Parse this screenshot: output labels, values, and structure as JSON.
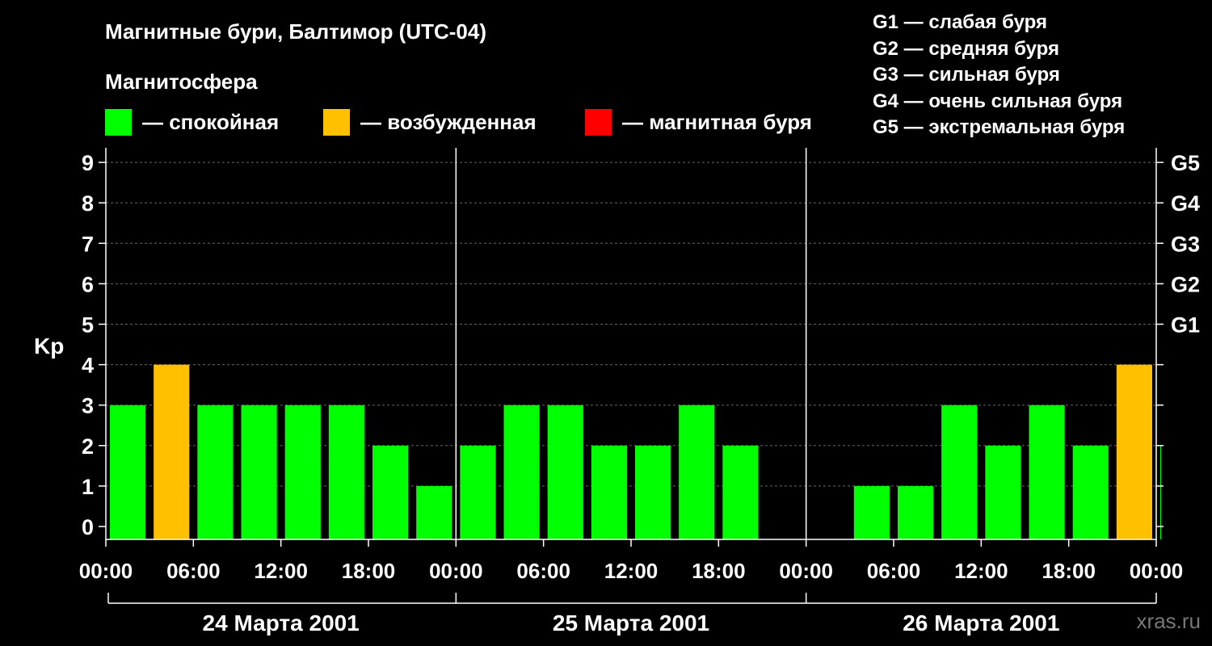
{
  "title": "Магнитные бури, Балтимор (UTC-04)",
  "subtitle": "Магнитосфера",
  "legend": [
    {
      "color": "#00ff00",
      "label": "— спокойная"
    },
    {
      "color": "#ffc000",
      "label": "— возбужденная"
    },
    {
      "color": "#ff0000",
      "label": "— магнитная буря"
    }
  ],
  "storm_levels": [
    "G1 — слабая буря",
    "G2 — средняя буря",
    "G3 — сильная буря",
    "G4 — очень сильная буря",
    "G5 — экстремальная буря"
  ],
  "watermark": "xras.ru",
  "chart_data": {
    "type": "bar",
    "ylabel": "Kp",
    "ylim": [
      0,
      9
    ],
    "yticks": [
      0,
      1,
      2,
      3,
      4,
      5,
      6,
      7,
      8,
      9
    ],
    "right_ticks": [
      {
        "value": 5,
        "label": "G1"
      },
      {
        "value": 6,
        "label": "G2"
      },
      {
        "value": 7,
        "label": "G3"
      },
      {
        "value": 8,
        "label": "G4"
      },
      {
        "value": 9,
        "label": "G5"
      }
    ],
    "grid": true,
    "x_tick_labels": [
      "00:00",
      "06:00",
      "12:00",
      "18:00",
      "00:00",
      "06:00",
      "12:00",
      "18:00",
      "00:00",
      "06:00",
      "12:00",
      "18:00",
      "00:00"
    ],
    "days": [
      "24 Марта 2001",
      "25 Марта 2001",
      "26 Марта 2001"
    ],
    "quiet_color": "#00ff00",
    "active_color": "#ffc000",
    "storm_color": "#ff0000",
    "bars": [
      {
        "day": 0,
        "hour": 0,
        "kp": 3
      },
      {
        "day": 0,
        "hour": 3,
        "kp": 4
      },
      {
        "day": 0,
        "hour": 6,
        "kp": 3
      },
      {
        "day": 0,
        "hour": 9,
        "kp": 3
      },
      {
        "day": 0,
        "hour": 12,
        "kp": 3
      },
      {
        "day": 0,
        "hour": 15,
        "kp": 3
      },
      {
        "day": 0,
        "hour": 18,
        "kp": 2
      },
      {
        "day": 0,
        "hour": 21,
        "kp": 1
      },
      {
        "day": 1,
        "hour": 0,
        "kp": 2
      },
      {
        "day": 1,
        "hour": 3,
        "kp": 3
      },
      {
        "day": 1,
        "hour": 6,
        "kp": 3
      },
      {
        "day": 1,
        "hour": 9,
        "kp": 2
      },
      {
        "day": 1,
        "hour": 12,
        "kp": 2
      },
      {
        "day": 1,
        "hour": 15,
        "kp": 3
      },
      {
        "day": 1,
        "hour": 18,
        "kp": 2
      },
      {
        "day": 2,
        "hour": 3,
        "kp": 1
      },
      {
        "day": 2,
        "hour": 6,
        "kp": 1
      },
      {
        "day": 2,
        "hour": 9,
        "kp": 3
      },
      {
        "day": 2,
        "hour": 12,
        "kp": 2
      },
      {
        "day": 2,
        "hour": 15,
        "kp": 3
      },
      {
        "day": 2,
        "hour": 18,
        "kp": 2
      },
      {
        "day": 2,
        "hour": 21,
        "kp": 4
      },
      {
        "day": 3,
        "hour": 0,
        "kp": 2
      }
    ]
  }
}
